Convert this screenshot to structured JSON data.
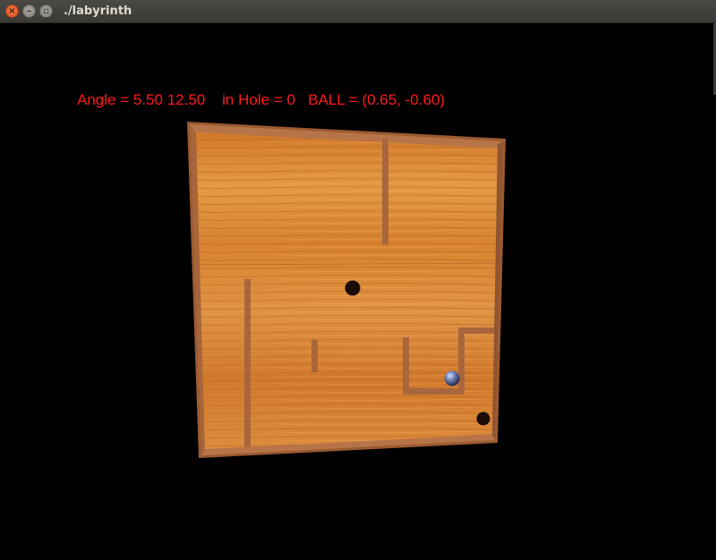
{
  "window": {
    "title": "./labyrinth",
    "close_glyph": "×",
    "minimize_glyph": "–",
    "maximize_glyph": "▫"
  },
  "hud": {
    "angle_label": "Angle =",
    "angle_x": "5.50",
    "angle_y": "12.50",
    "in_hole_label": "in Hole =",
    "in_hole_value": "0",
    "ball_label": "BALL =",
    "ball_value": "(0.65, -0.60)"
  },
  "scene": {
    "board_color": "#d57f2e",
    "board_highlight": "#e6a04a",
    "wall_color": "#a8643a",
    "frame_color": "#b26e3e",
    "hole_color": "#1a0c04",
    "ball_color": "#6f7fb4",
    "text_color": "#ff1a1a",
    "background_color": "#000000",
    "holes_count": 2,
    "balls_count": 1
  }
}
